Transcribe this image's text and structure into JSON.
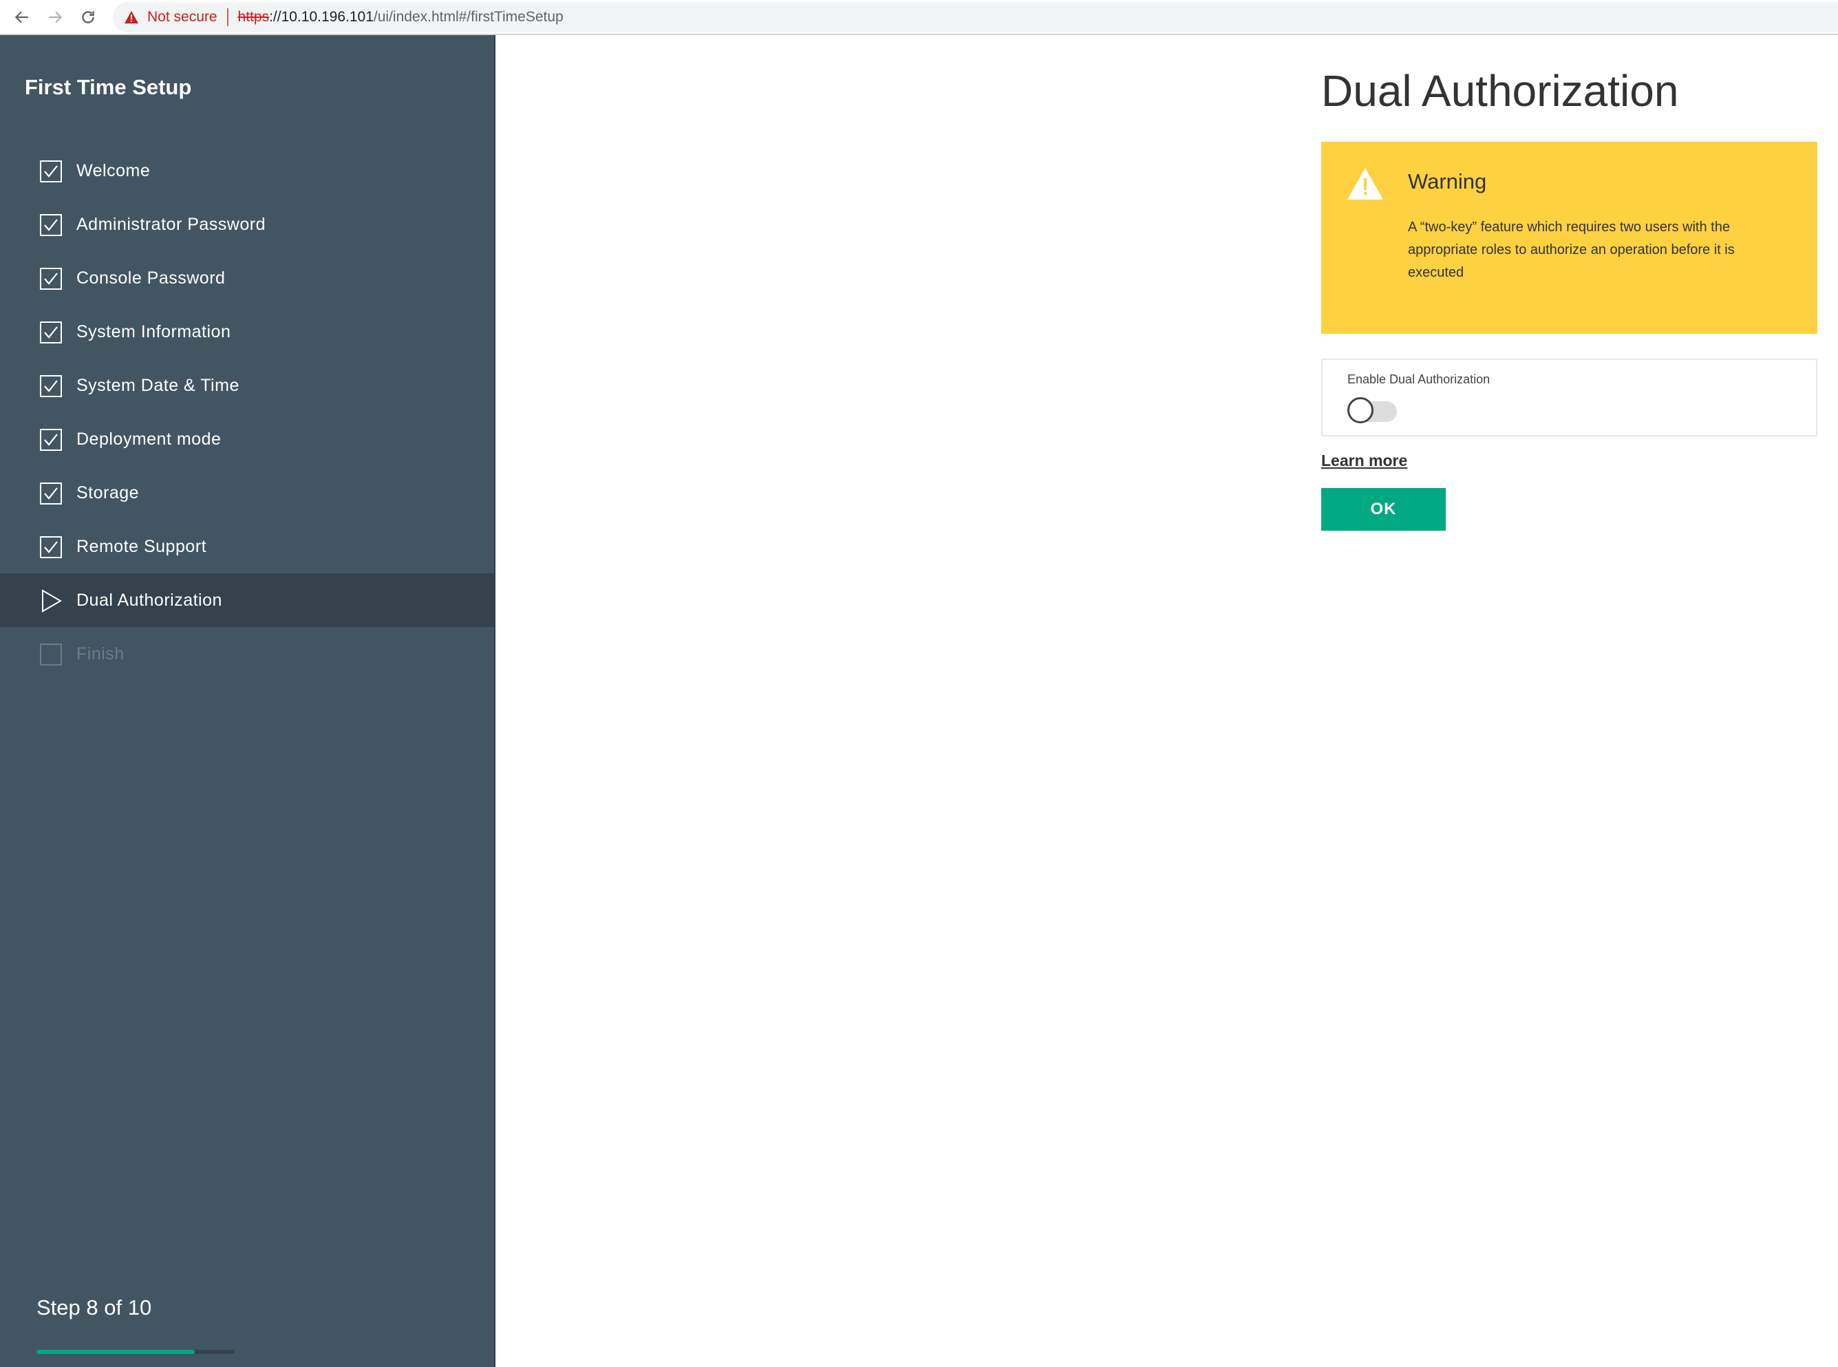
{
  "browser": {
    "security_label": "Not secure",
    "url_scheme": "https",
    "url_host": "://10.10.196.101",
    "url_path": "/ui/index.html#/firstTimeSetup"
  },
  "sidebar": {
    "title": "First Time Setup",
    "steps": [
      {
        "label": "Welcome",
        "state": "done"
      },
      {
        "label": "Administrator Password",
        "state": "done"
      },
      {
        "label": "Console Password",
        "state": "done"
      },
      {
        "label": "System Information",
        "state": "done"
      },
      {
        "label": "System Date & Time",
        "state": "done"
      },
      {
        "label": "Deployment mode",
        "state": "done"
      },
      {
        "label": "Storage",
        "state": "done"
      },
      {
        "label": "Remote Support",
        "state": "done"
      },
      {
        "label": "Dual Authorization",
        "state": "current"
      },
      {
        "label": "Finish",
        "state": "pending"
      }
    ],
    "step_counter": "Step 8 of 10",
    "progress_fraction": 0.8
  },
  "main": {
    "title": "Dual Authorization",
    "warning": {
      "title": "Warning",
      "text": "A “two-key” feature which requires two users with the appropriate roles to authorize an operation before it is executed"
    },
    "toggle": {
      "label": "Enable Dual Authorization",
      "enabled": false
    },
    "learn_more": "Learn more",
    "ok_label": "OK"
  },
  "colors": {
    "sidebar_bg": "#425563",
    "active_step_bg": "#33424d",
    "accent_green": "#01a982",
    "warning_yellow": "#fed141",
    "not_secure_red": "#c5221f"
  }
}
